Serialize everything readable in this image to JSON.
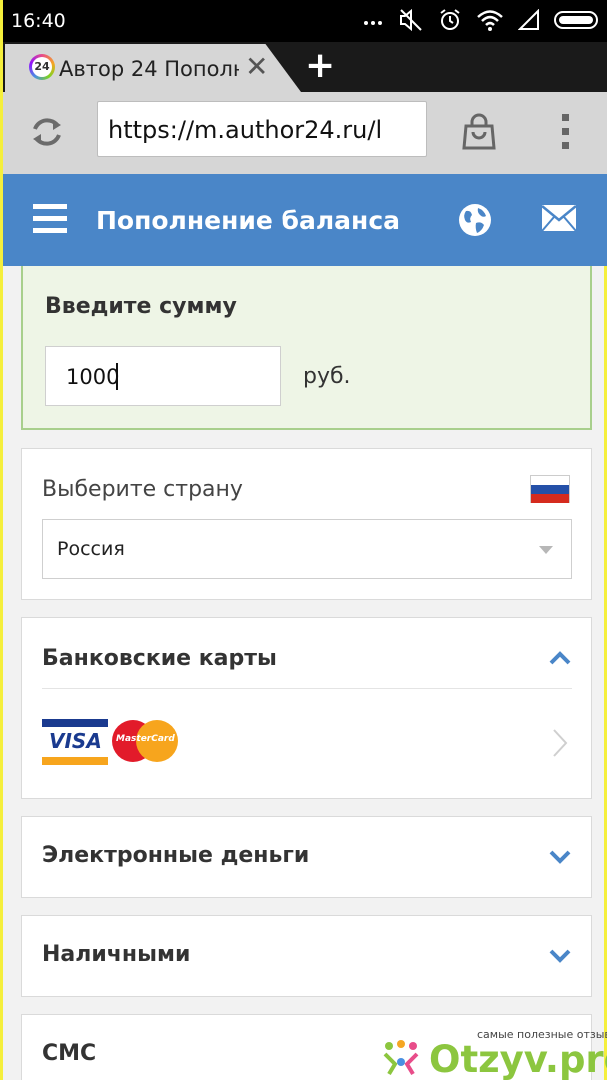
{
  "status_bar": {
    "time": "16:40"
  },
  "browser": {
    "tab_title": "Автор 24 Пополн",
    "favicon_text": "24",
    "url": "https://m.author24.ru/l"
  },
  "app_header": {
    "title": "Пополнение баланса"
  },
  "amount": {
    "label": "Введите сумму",
    "value": "1000",
    "unit": "руб."
  },
  "country": {
    "label": "Выберите страну",
    "selected": "Россия"
  },
  "bank_cards": {
    "title": "Банковские карты",
    "visa_text": "VISA",
    "mastercard_text": "MasterCard"
  },
  "sections": [
    {
      "title": "Электронные деньги"
    },
    {
      "title": "Наличными"
    },
    {
      "title": "СМС"
    }
  ],
  "watermark": {
    "tagline": "самые полезные отзывы",
    "brand": "Otzyv.pro"
  },
  "colors": {
    "header": "#4a86c8",
    "amount_bg": "#eef5e6",
    "amount_border": "#a8cf8c",
    "chevron": "#4a86c8"
  }
}
